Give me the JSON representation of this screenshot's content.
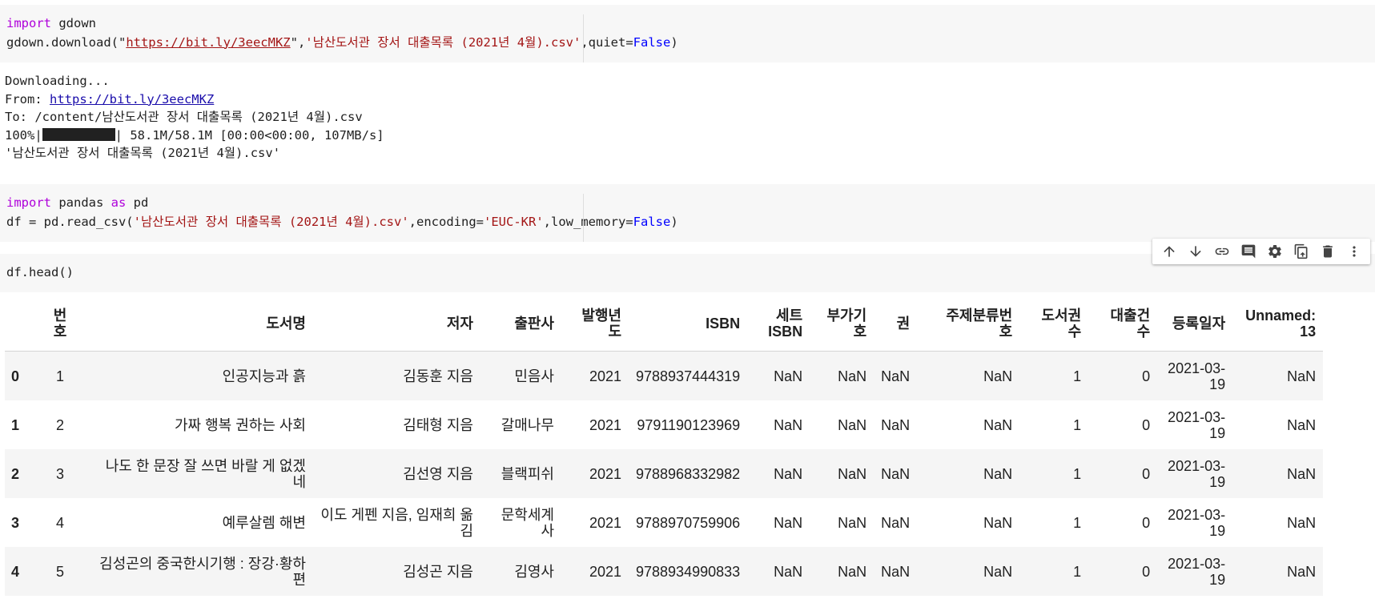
{
  "cell1": {
    "line1": [
      {
        "t": "import",
        "c": "kw"
      },
      {
        "t": " gdown",
        "c": ""
      }
    ],
    "line2": [
      {
        "t": "gdown.download(\"",
        "c": ""
      },
      {
        "t": "https://bit.ly/3eecMKZ",
        "c": "lnk"
      },
      {
        "t": "\",",
        "c": ""
      },
      {
        "t": "'남산도서관 장서 대출목록 (2021년 4월).csv'",
        "c": "str"
      },
      {
        "t": ",quiet=",
        "c": ""
      },
      {
        "t": "False",
        "c": "bool"
      },
      {
        "t": ")",
        "c": ""
      }
    ]
  },
  "output1": {
    "line1": "Downloading...",
    "from_label": "From: ",
    "from_url": "https://bit.ly/3eecMKZ",
    "line3": "To: /content/남산도서관 장서 대출목록 (2021년 4월).csv",
    "progress_pct": "100%|",
    "progress_rest": "| 58.1M/58.1M [00:00<00:00, 107MB/s]",
    "progress_fraction": 1.0,
    "line5": "'남산도서관 장서 대출목록 (2021년 4월).csv'"
  },
  "cell2": {
    "line1": [
      {
        "t": "import",
        "c": "kw"
      },
      {
        "t": " pandas ",
        "c": ""
      },
      {
        "t": "as",
        "c": "kw"
      },
      {
        "t": " pd",
        "c": ""
      }
    ],
    "line2": [
      {
        "t": "df = pd.read_csv(",
        "c": ""
      },
      {
        "t": "'남산도서관 장서 대출목록 (2021년 4월).csv'",
        "c": "str"
      },
      {
        "t": ",encoding=",
        "c": ""
      },
      {
        "t": "'EUC-KR'",
        "c": "str"
      },
      {
        "t": ",low_memory=",
        "c": ""
      },
      {
        "t": "False",
        "c": "bool"
      },
      {
        "t": ")",
        "c": ""
      }
    ]
  },
  "cell3": {
    "line1": [
      {
        "t": "df.head()",
        "c": ""
      }
    ]
  },
  "toolbar": {
    "icons": [
      "arrow-up-icon",
      "arrow-down-icon",
      "link-icon",
      "comment-icon",
      "gear-icon",
      "mirror-cell-icon",
      "trash-icon",
      "more-vert-icon"
    ]
  },
  "table": {
    "columns": [
      "번\n호",
      "도서명",
      "저자",
      "출판사",
      "발행년\n도",
      "ISBN",
      "세트\nISBN",
      "부가기\n호",
      "권",
      "주제분류번\n호",
      "도서권\n수",
      "대출건\n수",
      "등록일자",
      "Unnamed:\n13"
    ],
    "rows": [
      {
        "index": "0",
        "cells": [
          "1",
          "인공지능과 흙",
          "김동훈 지음",
          "민음사",
          "2021",
          "9788937444319",
          "NaN",
          "NaN",
          "NaN",
          "NaN",
          "1",
          "0",
          "2021-03-\n19",
          "NaN"
        ]
      },
      {
        "index": "1",
        "cells": [
          "2",
          "가짜 행복 권하는 사회",
          "김태형 지음",
          "갈매나무",
          "2021",
          "9791190123969",
          "NaN",
          "NaN",
          "NaN",
          "NaN",
          "1",
          "0",
          "2021-03-\n19",
          "NaN"
        ]
      },
      {
        "index": "2",
        "cells": [
          "3",
          "나도 한 문장 잘 쓰면 바랄 게 없겠\n네",
          "김선영 지음",
          "블랙피쉬",
          "2021",
          "9788968332982",
          "NaN",
          "NaN",
          "NaN",
          "NaN",
          "1",
          "0",
          "2021-03-\n19",
          "NaN"
        ]
      },
      {
        "index": "3",
        "cells": [
          "4",
          "예루살렘 해변",
          "이도 게펜 지음, 임재희 옮\n김",
          "문학세계\n사",
          "2021",
          "9788970759906",
          "NaN",
          "NaN",
          "NaN",
          "NaN",
          "1",
          "0",
          "2021-03-\n19",
          "NaN"
        ]
      },
      {
        "index": "4",
        "cells": [
          "5",
          "김성곤의 중국한시기행 : 장강·황하\n편",
          "김성곤 지음",
          "김영사",
          "2021",
          "9788934990833",
          "NaN",
          "NaN",
          "NaN",
          "NaN",
          "1",
          "0",
          "2021-03-\n19",
          "NaN"
        ]
      }
    ]
  }
}
